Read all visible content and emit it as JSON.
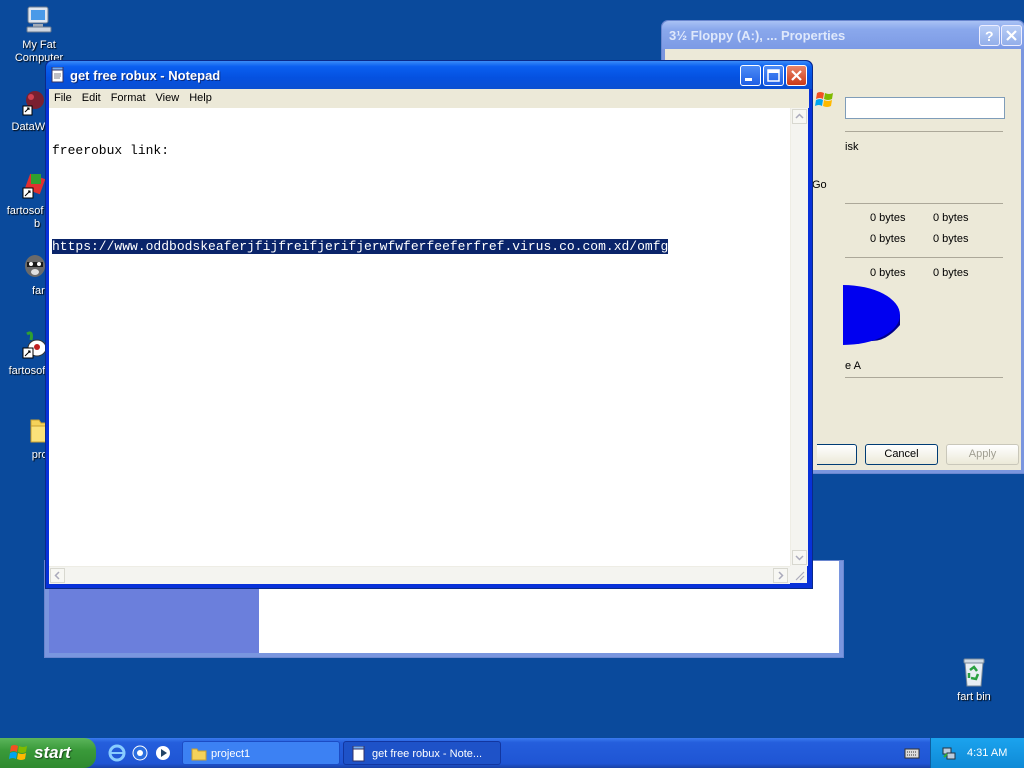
{
  "desktop": {
    "icons": [
      {
        "label": "My Fat Computer",
        "name": "computer-icon"
      },
      {
        "label": "DataWar",
        "name": "datawar-icon"
      },
      {
        "label": "fartosof blah b",
        "name": "shortcut-icon"
      },
      {
        "label": "fartp",
        "name": "raccoon-icon"
      },
      {
        "label": "fartosof blal",
        "name": "shortcut-icon"
      },
      {
        "label": "proje",
        "name": "folder-icon"
      }
    ],
    "recycle_bin": {
      "label": "fart bin"
    }
  },
  "notepad": {
    "title": "get free robux - Notepad",
    "menu": [
      "File",
      "Edit",
      "Format",
      "View",
      "Help"
    ],
    "lines": [
      "freerobux link:",
      "",
      "https://www.oddbodskeaferjfijfreifjerifjerwfwferfeeferfref.virus.co.com.xd/omfg"
    ]
  },
  "properties": {
    "title": "3½ Floppy (A:), ... Properties",
    "rows": [
      {
        "a": "0 bytes",
        "b": "0 bytes"
      },
      {
        "a": "0 bytes",
        "b": "0 bytes"
      },
      {
        "a": "0 bytes",
        "b": "0 bytes"
      }
    ],
    "type_text": "isk",
    "go_label": "Go",
    "drive_label": "e A",
    "cancel": "Cancel",
    "apply": "Apply"
  },
  "taskbar": {
    "start": "start",
    "items": [
      {
        "label": "project1"
      },
      {
        "label": "get free robux - Note..."
      }
    ],
    "clock": "4:31 AM"
  },
  "colors": {
    "desktop": "#0a4a9c",
    "pie": "#0000f0",
    "selection": "#0a246a"
  }
}
